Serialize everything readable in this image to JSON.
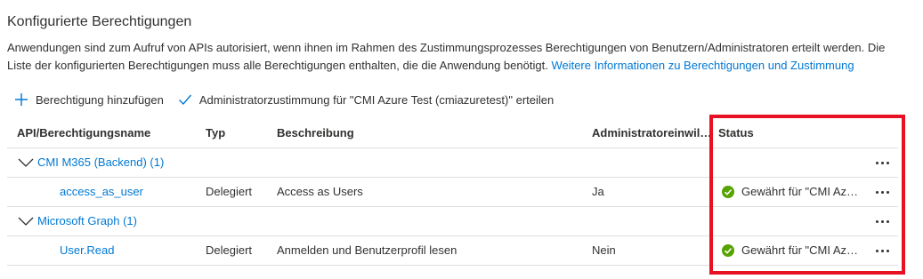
{
  "section": {
    "title": "Konfigurierte Berechtigungen",
    "description": "Anwendungen sind zum Aufruf von APIs autorisiert, wenn ihnen im Rahmen des Zustimmungsprozesses Berechtigungen von Benutzern/Administratoren erteilt werden. Die Liste der konfigurierten Berechtigungen muss alle Berechtigungen enthalten, die die Anwendung benötigt.",
    "link_text": "Weitere Informationen zu Berechtigungen und Zustimmung"
  },
  "toolbar": {
    "add_label": "Berechtigung hinzufügen",
    "grant_label": "Administratorzustimmung für \"CMI Azure Test (cmiazuretest)\" erteilen"
  },
  "table": {
    "headers": {
      "name": "API/Berechtigungsname",
      "type": "Typ",
      "description": "Beschreibung",
      "admin": "Administratoreinwill...",
      "status": "Status"
    },
    "groups": [
      {
        "label": "CMI M365 (Backend) (1)",
        "items": [
          {
            "name": "access_as_user",
            "type": "Delegiert",
            "description": "Access as Users",
            "admin": "Ja",
            "status": "Gewährt für \"CMI Azure Test (cmiazuretest)\""
          }
        ]
      },
      {
        "label": "Microsoft Graph (1)",
        "items": [
          {
            "name": "User.Read",
            "type": "Delegiert",
            "description": "Anmelden und Benutzerprofil lesen",
            "admin": "Nein",
            "status": "Gewährt für \"CMI Azure Test (cmiazuretest)\""
          }
        ]
      }
    ]
  },
  "colors": {
    "link": "#0078d4",
    "success": "#57a300",
    "highlight": "#e81123"
  },
  "icons": {
    "add": "plus-icon",
    "grant": "checkmark-icon",
    "expand": "chevron-down-icon",
    "status": "success-check-icon",
    "more": "more-icon"
  }
}
